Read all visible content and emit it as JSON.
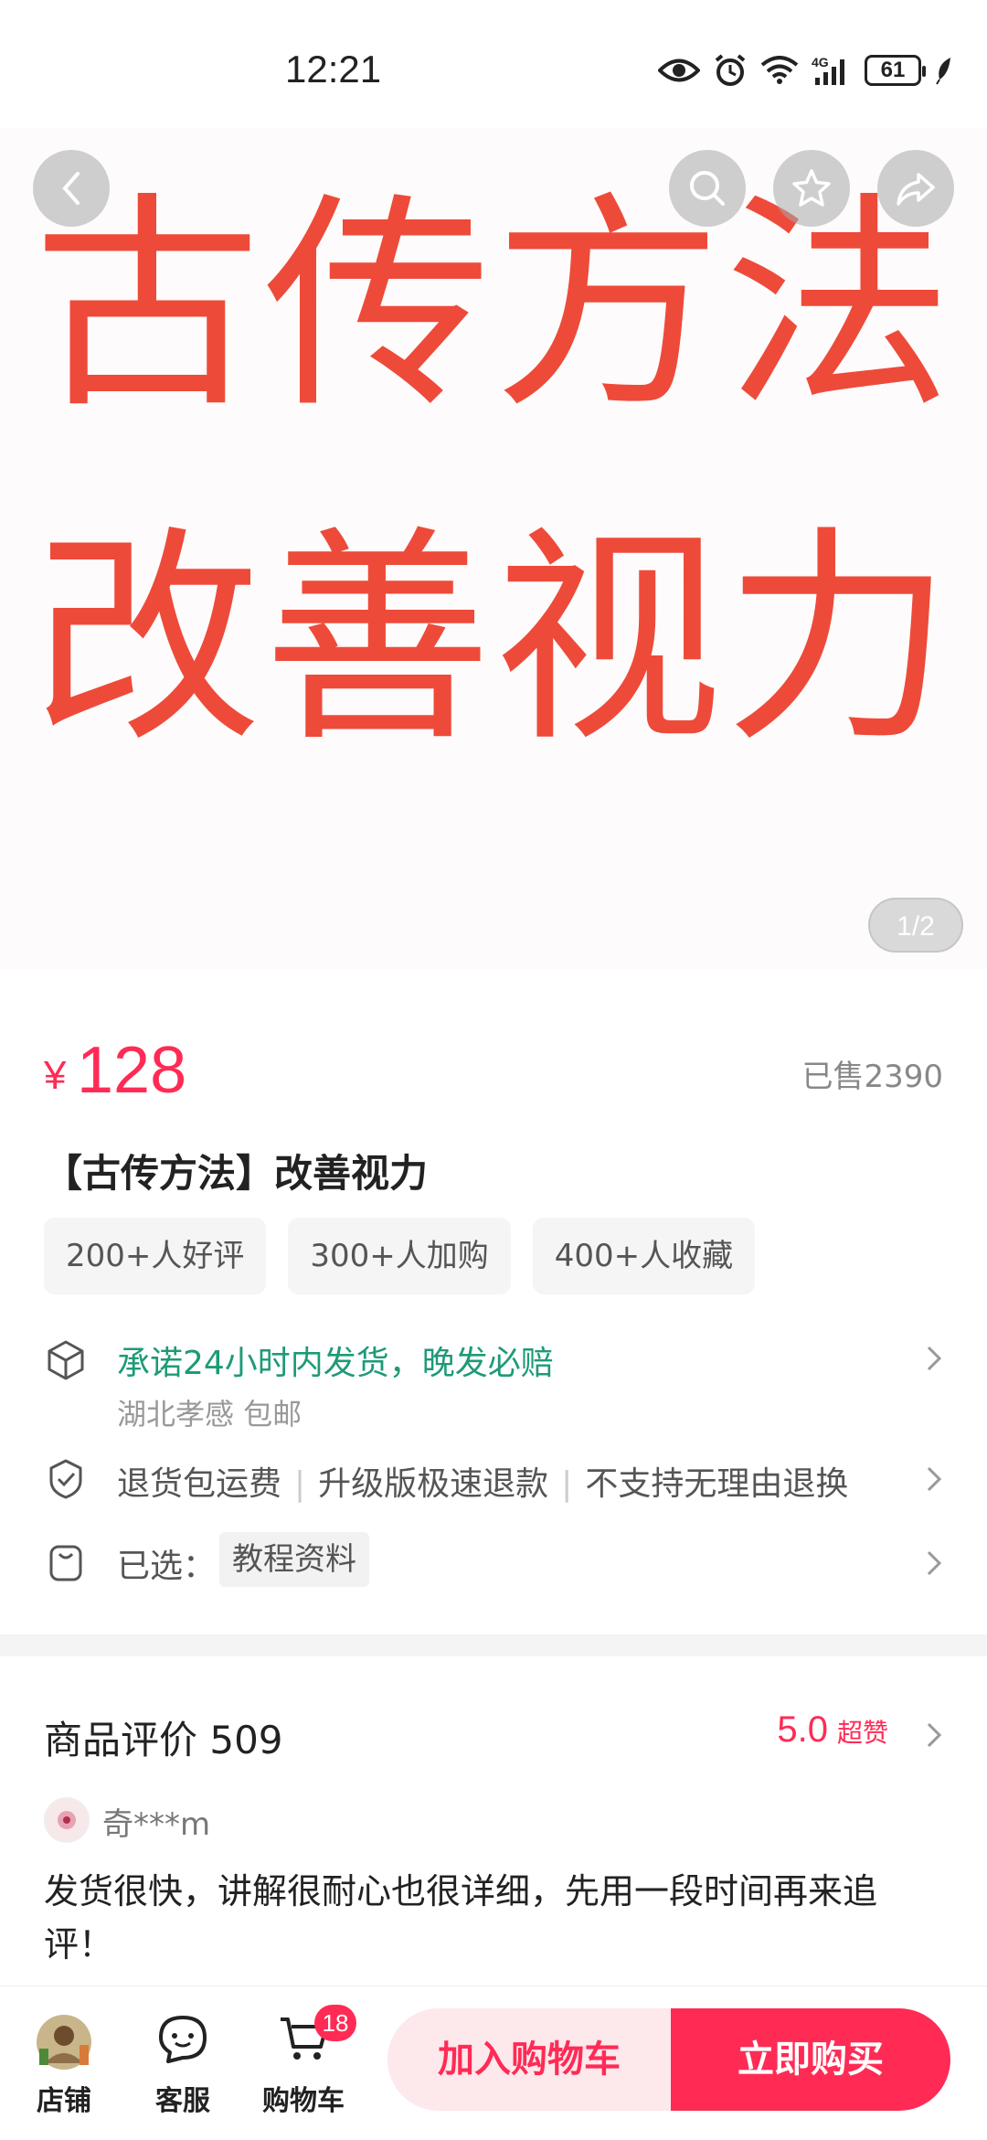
{
  "status_bar": {
    "time": "12:21",
    "network": "4G",
    "battery": "61"
  },
  "hero": {
    "line1": "古传方法",
    "line2": "改善视力",
    "page_indicator": "1/2"
  },
  "product": {
    "currency": "¥",
    "price": "128",
    "sold": "已售2390",
    "title": "【古传方法】改善视力",
    "tags": [
      "200+人好评",
      "300+人加购",
      "400+人收藏"
    ]
  },
  "shipping": {
    "promise": "承诺24小时内发货，晚发必赔",
    "origin": "湖北孝感 包邮"
  },
  "service": {
    "items": [
      "退货包运费",
      "升级版极速退款",
      "不支持无理由退换"
    ]
  },
  "selection": {
    "label": "已选：",
    "value": "教程资料"
  },
  "reviews": {
    "title": "商品评价 509",
    "score": "5.0",
    "score_label": "超赞",
    "reviewer": "奇***m",
    "text": "发货很快，讲解很耐心也很详细，先用一段时间再来追评！"
  },
  "bottom_bar": {
    "shop_label": "店铺",
    "service_label": "客服",
    "cart_label": "购物车",
    "cart_count": "18",
    "add_to_cart": "加入购物车",
    "buy_now": "立即购买"
  },
  "colors": {
    "accent": "#ff2b55",
    "hero_text": "#ee4a3a",
    "shipping_green": "#1e9a78"
  }
}
